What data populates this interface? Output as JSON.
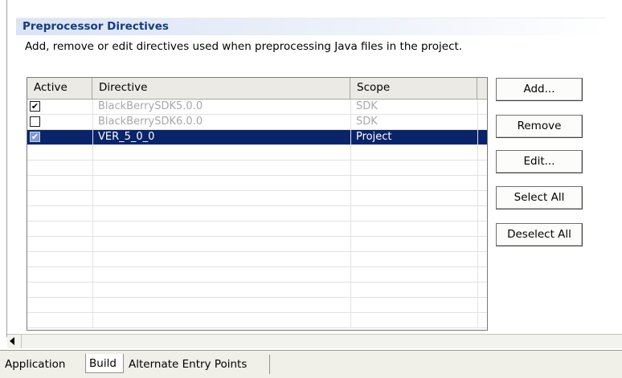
{
  "section": {
    "title": "Preprocessor Directives",
    "description": "Add, remove or edit directives used when preprocessing Java files in the project."
  },
  "table": {
    "columns": [
      "Active",
      "Directive",
      "Scope"
    ],
    "rows": [
      {
        "active": true,
        "active_mark": "✔",
        "directive": "BlackBerrySDK5.0.0",
        "scope": "SDK",
        "disabled": true,
        "selected": false
      },
      {
        "active": false,
        "active_mark": "",
        "directive": "BlackBerrySDK6.0.0",
        "scope": "SDK",
        "disabled": true,
        "selected": false
      },
      {
        "active": true,
        "active_mark": "✔",
        "directive": "VER_5_0_0",
        "scope": "Project",
        "disabled": false,
        "selected": true
      }
    ],
    "empty_row_count": 9
  },
  "buttons": {
    "add": "Add...",
    "remove": "Remove",
    "edit": "Edit...",
    "select_all": "Select All",
    "deselect_all": "Deselect All"
  },
  "tabs": [
    {
      "label": "Application",
      "active": false
    },
    {
      "label": "Build",
      "active": true
    },
    {
      "label": "Alternate Entry Points",
      "active": false
    }
  ],
  "colors": {
    "selection": "#0a246a",
    "section_title": "#153b83",
    "disabled_text": "#a8a8a8"
  }
}
